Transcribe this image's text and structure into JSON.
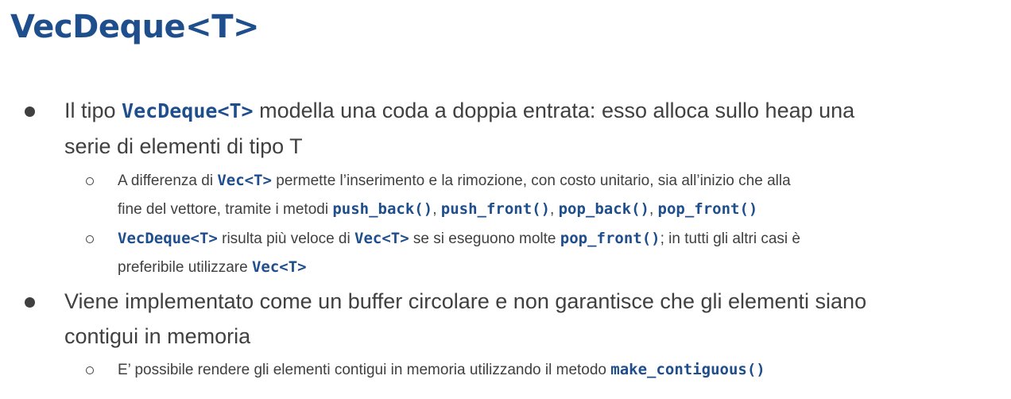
{
  "slide": {
    "title": "VecDeque<T>",
    "accent_color": "#1f4e8c",
    "text_color": "#404040"
  },
  "bullets": [
    {
      "line1": {
        "pre": "Il tipo ",
        "code": "VecDeque<T>",
        "post": " modella una coda a doppia entrata: esso alloca sullo heap una"
      },
      "line2": "serie di elementi di tipo T",
      "subs": [
        {
          "line1": {
            "pre": "A differenza di ",
            "code": "Vec<T>",
            "post": " permette l’inserimento e la rimozione, con costo unitario, sia all’inizio che alla"
          },
          "line2": {
            "pre": "fine del vettore, tramite i metodi ",
            "code1": "push_back()",
            "sep1": ", ",
            "code2": "push_front()",
            "sep2": ", ",
            "code3": "pop_back()",
            "sep3": ", ",
            "code4": "pop_front()"
          }
        },
        {
          "line1": {
            "code1": "VecDeque<T>",
            "mid1": " risulta più veloce di ",
            "code2": "Vec<T>",
            "mid2": " se si eseguono molte ",
            "code3": "pop_front()",
            "post": "; in tutti gli altri casi è"
          },
          "line2": {
            "pre": "preferibile utilizzare ",
            "code": "Vec<T>"
          }
        }
      ]
    },
    {
      "line1": "Viene implementato come un buffer circolare e non garantisce che gli elementi siano",
      "line2": "contigui in memoria",
      "subs": [
        {
          "line1": {
            "pre": "E’ possibile rendere gli elementi contigui in memoria utilizzando il metodo ",
            "code": "make_contiguous()"
          }
        }
      ]
    }
  ]
}
